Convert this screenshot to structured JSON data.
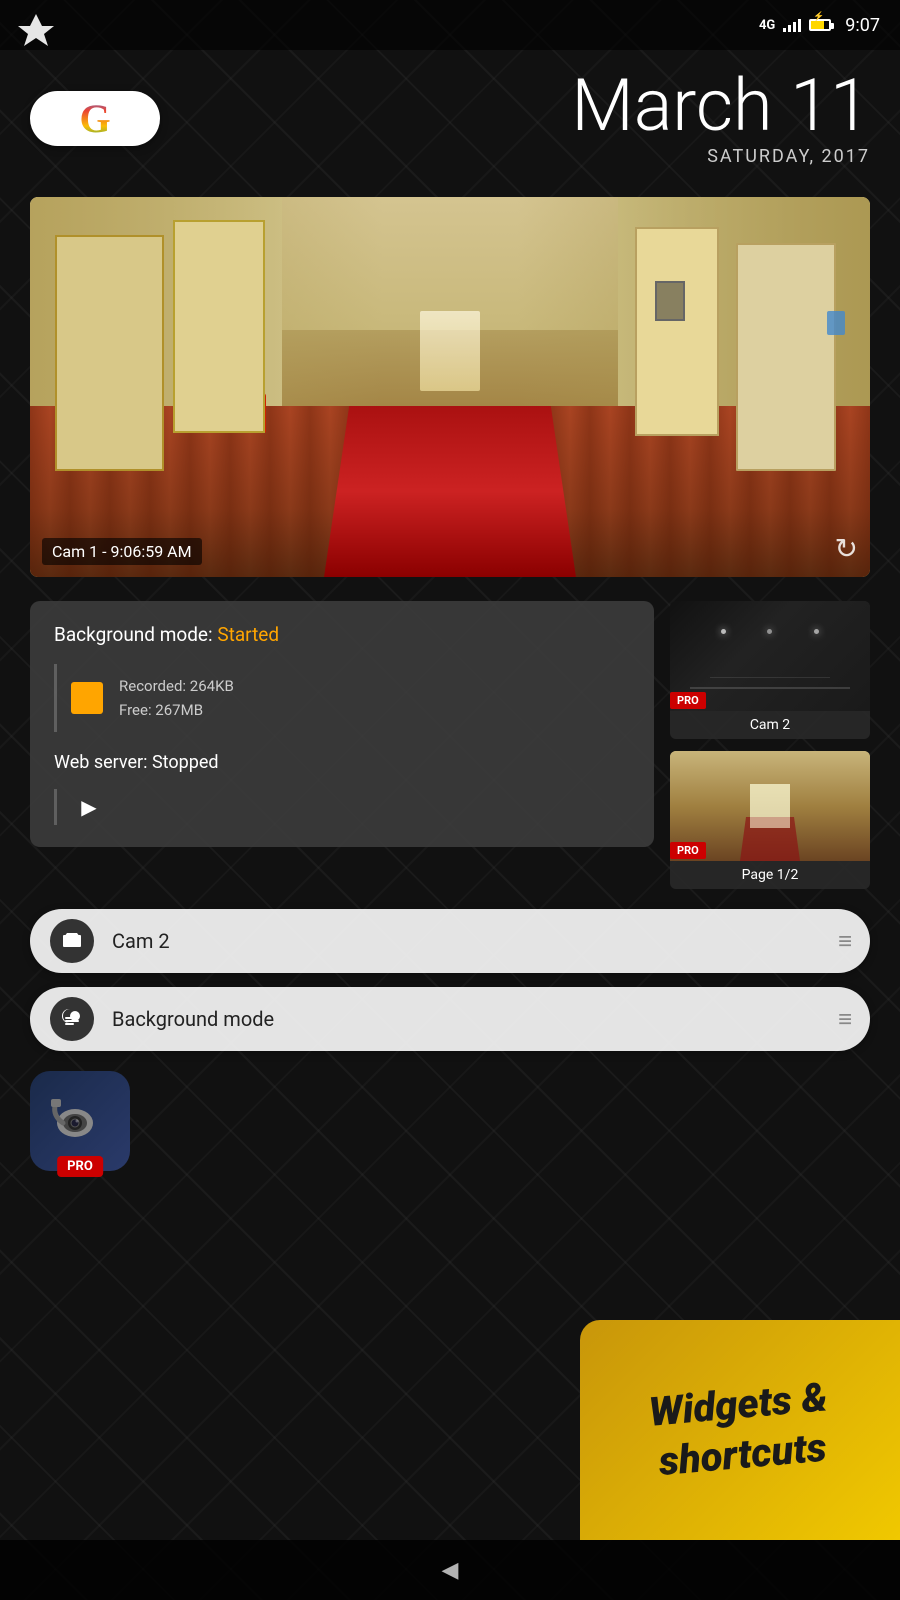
{
  "statusBar": {
    "network": "4G",
    "time": "9:07"
  },
  "header": {
    "googleLabel": "G",
    "date": "March 11",
    "dayOfWeek": "SATURDAY, 2017"
  },
  "camera": {
    "label": "Cam 1 - 9:06:59 AM",
    "refreshIcon": "↻"
  },
  "backgroundMode": {
    "label": "Background mode:",
    "status": "Started",
    "recorded": "Recorded: 264KB",
    "free": "Free: 267MB"
  },
  "webServer": {
    "label": "Web server: Stopped"
  },
  "thumbnails": [
    {
      "label": "Cam 2",
      "type": "dark"
    },
    {
      "label": "Page 1/2",
      "type": "hallway"
    }
  ],
  "shortcuts": [
    {
      "label": "Cam 2",
      "iconType": "camera"
    },
    {
      "label": "Background mode",
      "iconType": "sleep"
    }
  ],
  "appIcon": {
    "proBadge": "PRO"
  },
  "promo": {
    "text": "Widgets &\nshortcuts"
  },
  "bottomNav": {
    "backIcon": "◀"
  }
}
